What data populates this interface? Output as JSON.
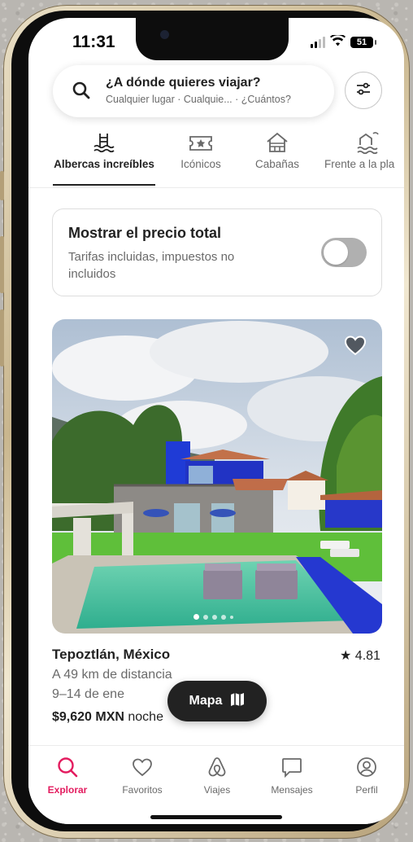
{
  "status_bar": {
    "time": "11:31",
    "battery": "51"
  },
  "search": {
    "title": "¿A dónde quieres viajar?",
    "subtitle": "Cualquier lugar · Cualquie... · ¿Cuántos?",
    "icon": "search-icon",
    "filter_icon": "sliders-icon"
  },
  "categories": [
    {
      "label": "Albercas increíbles",
      "icon": "pool-icon",
      "active": true
    },
    {
      "label": "Icónicos",
      "icon": "ticket-star-icon",
      "active": false
    },
    {
      "label": "Cabañas",
      "icon": "cabin-icon",
      "active": false
    },
    {
      "label": "Frente a la pla",
      "icon": "beachfront-icon",
      "active": false
    }
  ],
  "price_toggle": {
    "title": "Mostrar el precio total",
    "subtitle": "Tarifas incluidas, impuestos no incluidos",
    "enabled": false
  },
  "listing": {
    "location": "Tepoztlán, México",
    "rating": "4.81",
    "distance": "A 49 km de distancia",
    "dates": "9–14 de ene",
    "price": "$9,620 MXN",
    "price_unit": " noche",
    "photo_count_dots": 5,
    "favorited": false
  },
  "map_button": {
    "label": "Mapa",
    "icon": "map-icon"
  },
  "tabs": [
    {
      "label": "Explorar",
      "icon": "search-icon",
      "active": true
    },
    {
      "label": "Favoritos",
      "icon": "heart-icon",
      "active": false
    },
    {
      "label": "Viajes",
      "icon": "airbnb-logo-icon",
      "active": false
    },
    {
      "label": "Mensajes",
      "icon": "message-icon",
      "active": false
    },
    {
      "label": "Perfil",
      "icon": "profile-icon",
      "active": false
    }
  ],
  "colors": {
    "accent": "#e31c5f",
    "text": "#222222",
    "muted": "#6a6a6a",
    "toggle_off": "#b0b0b0"
  }
}
